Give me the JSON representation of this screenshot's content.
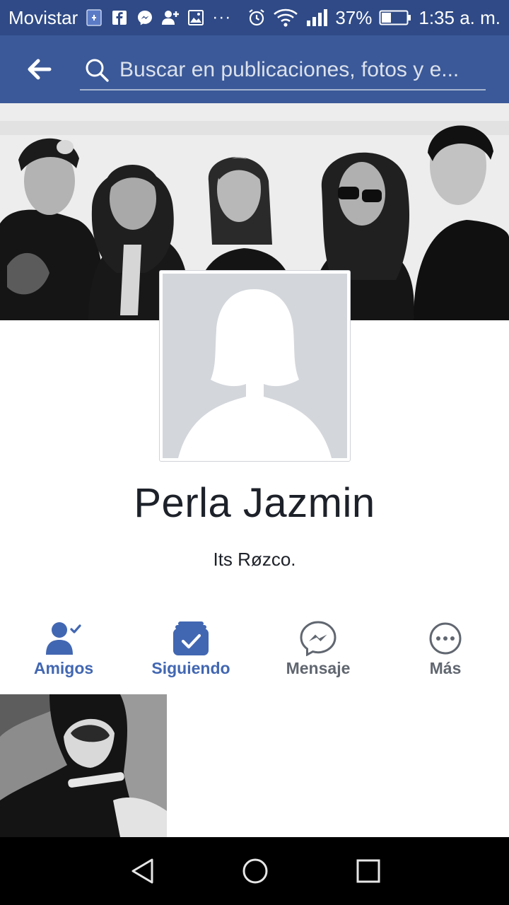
{
  "status_bar": {
    "carrier": "Movistar",
    "battery_percent": "37%",
    "time": "1:35 a. m.",
    "overflow": "···",
    "icons": [
      "sim-card-icon",
      "facebook-notification-icon",
      "messenger-notification-icon",
      "friend-request-icon",
      "image-notification-icon",
      "alarm-icon",
      "wifi-icon",
      "signal-icon",
      "battery-icon"
    ]
  },
  "app_bar": {
    "back_icon": "arrow-left-icon",
    "search": {
      "icon": "search-icon",
      "placeholder": "Buscar en publicaciones, fotos y e..."
    }
  },
  "profile": {
    "name": "Perla Jazmin",
    "bio": "Its Røzco."
  },
  "actions": [
    {
      "label": "Amigos",
      "icon": "friends-check-icon",
      "active": true
    },
    {
      "label": "Siguiendo",
      "icon": "following-check-icon",
      "active": true
    },
    {
      "label": "Mensaje",
      "icon": "messenger-icon",
      "active": false
    },
    {
      "label": "Más",
      "icon": "more-dots-icon",
      "active": false
    }
  ],
  "nav_bar": {
    "buttons": [
      "back-triangle-icon",
      "home-circle-icon",
      "recents-square-icon"
    ]
  },
  "colors": {
    "status_bar": "#2f4a86",
    "app_bar": "#3b5998",
    "accent": "#4267b2",
    "muted": "#616770",
    "placeholder_avatar": "#d3d6db"
  }
}
